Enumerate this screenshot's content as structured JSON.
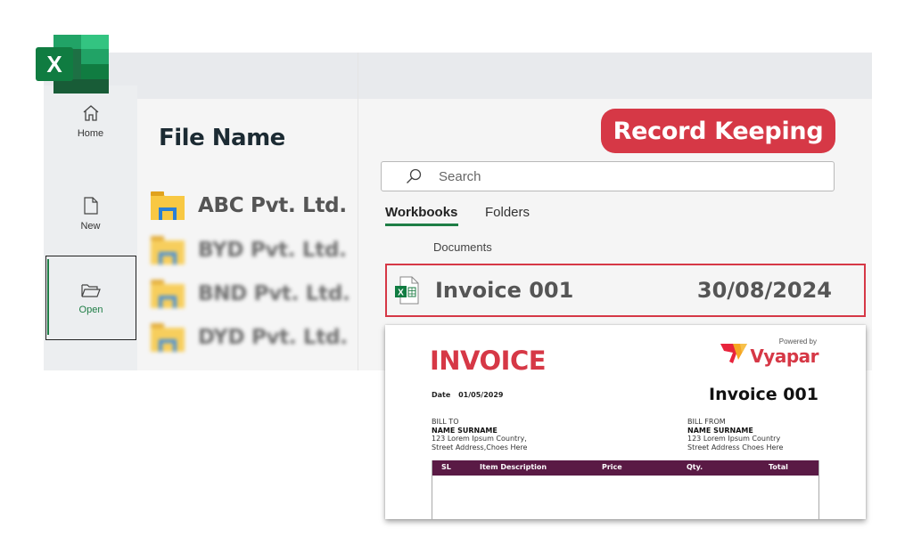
{
  "app": {
    "logo_letter": "X",
    "accent_color": "#1e7d45",
    "highlight_color": "#d63846"
  },
  "sidebar": {
    "items": [
      {
        "label": "Home",
        "icon": "home-icon"
      },
      {
        "label": "New",
        "icon": "new-file-icon"
      },
      {
        "label": "Open",
        "icon": "folder-open-icon",
        "active": true
      }
    ]
  },
  "files_panel": {
    "title": "File Name",
    "folders": [
      {
        "name": "ABC Pvt. Ltd.",
        "blurred": false
      },
      {
        "name": "BYD Pvt. Ltd.",
        "blurred": true
      },
      {
        "name": "BND Pvt. Ltd.",
        "blurred": true
      },
      {
        "name": "DYD Pvt. Ltd.",
        "blurred": true
      }
    ]
  },
  "main": {
    "badge": "Record Keeping",
    "search": {
      "placeholder": "Search",
      "value": ""
    },
    "tabs": [
      {
        "label": "Workbooks",
        "active": true
      },
      {
        "label": "Folders",
        "active": false
      }
    ],
    "section_label": "Documents",
    "file": {
      "name": "Invoice 001",
      "date": "30/08/2024"
    }
  },
  "invoice_preview": {
    "title": "INVOICE",
    "date_label": "Date",
    "date_value": "01/05/2029",
    "number": "Invoice 001",
    "powered_by": "Powered by",
    "brand": "Vyapar",
    "bill_to": {
      "label": "BILL TO",
      "name": "NAME SURNAME",
      "line1": "123 Lorem Ipsum Country,",
      "line2": "Street Address,Choes Here"
    },
    "bill_from": {
      "label": "BILL FROM",
      "name": "NAME SURNAME",
      "line1": "123 Lorem Ipsum Country",
      "line2": "Street Address Choes Here"
    },
    "table_headers": [
      "SL",
      "Item Description",
      "Price",
      "Qty.",
      "Total"
    ]
  }
}
